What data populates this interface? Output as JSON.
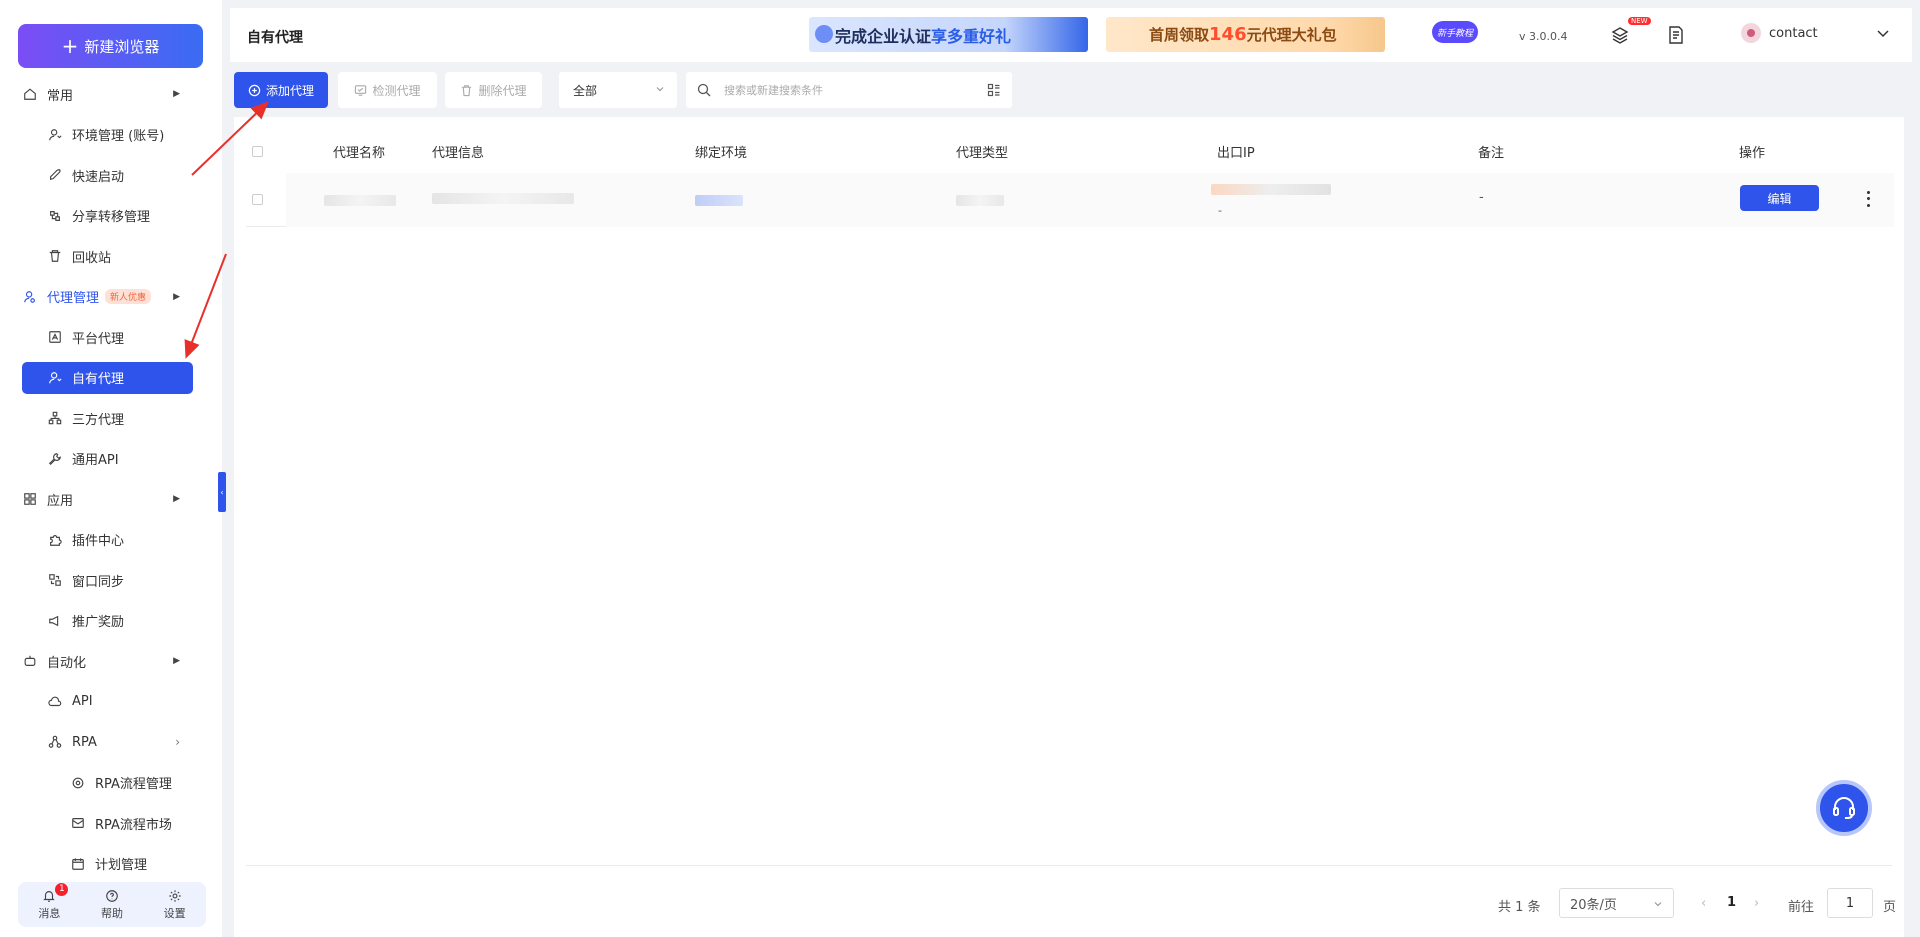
{
  "sidebar": {
    "new_browser": "新建浏览器",
    "items": [
      {
        "label": "常用",
        "icon": "home-icon",
        "level": "group"
      },
      {
        "label": "环境管理 (账号)",
        "icon": "user-icon",
        "level": "sub"
      },
      {
        "label": "快速启动",
        "icon": "rocket-icon",
        "level": "sub"
      },
      {
        "label": "分享转移管理",
        "icon": "share-icon",
        "level": "sub"
      },
      {
        "label": "回收站",
        "icon": "trash-icon",
        "level": "sub"
      },
      {
        "label": "代理管理",
        "icon": "proxy-icon",
        "level": "group",
        "badge": "新人优惠"
      },
      {
        "label": "平台代理",
        "icon": "platform-icon",
        "level": "sub"
      },
      {
        "label": "自有代理",
        "icon": "user-icon",
        "level": "sub"
      },
      {
        "label": "三方代理",
        "icon": "network-icon",
        "level": "sub"
      },
      {
        "label": "通用API",
        "icon": "wrench-icon",
        "level": "sub"
      },
      {
        "label": "应用",
        "icon": "apps-icon",
        "level": "group"
      },
      {
        "label": "插件中心",
        "icon": "puzzle-icon",
        "level": "sub"
      },
      {
        "label": "窗口同步",
        "icon": "sync-icon",
        "level": "sub"
      },
      {
        "label": "推广奖励",
        "icon": "megaphone-icon",
        "level": "sub"
      },
      {
        "label": "自动化",
        "icon": "robot-icon",
        "level": "group"
      },
      {
        "label": "API",
        "icon": "cloud-icon",
        "level": "sub"
      },
      {
        "label": "RPA",
        "icon": "flow-icon",
        "level": "sub"
      },
      {
        "label": "RPA流程管理",
        "icon": "target-icon",
        "level": "sub2"
      },
      {
        "label": "RPA流程市场",
        "icon": "mail-icon",
        "level": "sub2"
      },
      {
        "label": "计划管理",
        "icon": "calendar-icon",
        "level": "sub2"
      }
    ],
    "bottom": {
      "messages": "消息",
      "messages_count": "1",
      "help": "帮助",
      "settings": "设置"
    }
  },
  "header": {
    "title": "自有代理",
    "banner1_a": "完成企业认证",
    "banner1_b": "享多重好礼",
    "banner2_a": "首周领取",
    "banner2_b": "146",
    "banner2_c": "元代理大礼包",
    "tutorial": "新手教程",
    "version": "v 3.0.0.4",
    "new_tag": "NEW",
    "username": "contact"
  },
  "toolbar": {
    "add_proxy": "添加代理",
    "check_proxy": "检测代理",
    "delete_proxy": "删除代理",
    "filter_value": "全部",
    "search_placeholder": "搜索或新建搜索条件"
  },
  "table": {
    "columns": [
      "代理名称",
      "代理信息",
      "绑定环境",
      "代理类型",
      "出口IP",
      "备注",
      "操作"
    ],
    "rows": [
      {
        "export_ip_sub": "-",
        "remark": "-",
        "edit_label": "编辑"
      }
    ]
  },
  "pagination": {
    "total": "共 1 条",
    "page_size": "20条/页",
    "prev": "‹",
    "current": "1",
    "next": "›",
    "goto_label": "前往",
    "goto_value": "1",
    "page_suffix": "页"
  },
  "colors": {
    "primary": "#2f54eb",
    "brand_gradient_start": "#7b4df5",
    "annotation_arrow": "#e8302b"
  }
}
